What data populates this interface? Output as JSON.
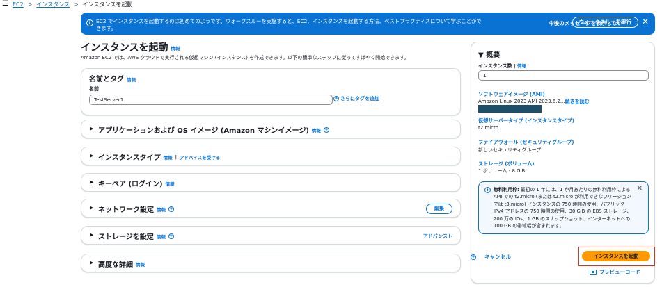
{
  "breadcrumb": {
    "menu_icon": "hamburger-icon",
    "items": [
      "EC2",
      "インスタンス",
      "インスタンスを起動"
    ],
    "separator": ">"
  },
  "flash": {
    "text": "EC2 でインスタンスを起動するのは初めてのようです。ウォークスルーを実施すると、EC2、インスタンスを起動する方法、ベストプラクティスについて学ぶことができます。",
    "dismiss_label": "今後のメッセージを表示しない",
    "walkthrough_label": "ウォークスルーを実行",
    "close_symbol": "✕",
    "color": "#0972d3"
  },
  "header": {
    "title": "インスタンスを起動",
    "info": "情報",
    "description": "Amazon EC2 では、AWS クラウドで実行される仮想マシン (インスタンス) を作成できます。以下の簡単なステップに従ってすばやく開始できます。"
  },
  "name_tags": {
    "title": "名前とタグ",
    "info": "情報",
    "name_label": "名前",
    "name_value": "TestServer1",
    "add_tag_label": "さらにタグを追加"
  },
  "sections": [
    {
      "title": "アプリケーションおよび OS イメージ (Amazon マシンイメージ)",
      "info": "情報"
    },
    {
      "title": "インスタンスタイプ",
      "info": "情報",
      "extra": "アドバイスを受ける"
    },
    {
      "title": "キーペア (ログイン)",
      "info": "情報"
    },
    {
      "title": "ネットワーク設定",
      "info": "情報",
      "button": "編集"
    },
    {
      "title": "ストレージを設定",
      "info": "情報",
      "link": "アドバンスト"
    },
    {
      "title": "高度な詳細",
      "info": "情報"
    }
  ],
  "summary": {
    "title": "概要",
    "count_label": "インスタンス数",
    "count_info": "情報",
    "count_value": "1",
    "ami_link": "ソフトウェアイメージ (AMI)",
    "ami_value": "Amazon Linux 2023 AMI 2023.6.2...",
    "ami_more": "続きを読む",
    "type_link": "仮想サーバータイプ (インスタンスタイプ)",
    "type_value": "t2.micro",
    "fw_link": "ファイアウォール (セキュリティグループ)",
    "fw_value": "新しいセキュリティグループ",
    "storage_link": "ストレージ (ボリューム)",
    "storage_value": "1 ボリューム - 8 GiB",
    "free_tier_title": "無料利用枠:",
    "free_tier_text": "最初の 1 年には、1 か月あたりの無料利用枠による AMI での t2.micro (または t2.micro が利用できないリージョンでは t3.micro) インスタンスの 750 時間の使用、パブリック IPv4 アドレスの 750 時間の使用、30 GiB の EBS ストレージ、200 万の IOs、1 GB のスナップショット、インターネットへの 100 GB の帯域幅が含まれます。",
    "cancel_label": "キャンセル",
    "launch_label": "インスタンスを起動",
    "preview_label": "プレビューコード",
    "launch_color": "#ff9900",
    "highlight_color": "#e0321c"
  }
}
